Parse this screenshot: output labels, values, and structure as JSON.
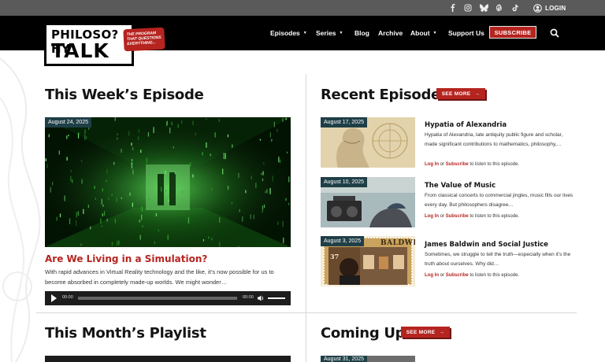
{
  "topbar": {
    "social": [
      "facebook-icon",
      "instagram-icon",
      "bluesky-icon",
      "threads-icon",
      "tiktok-icon"
    ],
    "login_label": "LOGIN"
  },
  "brand": {
    "line1": "PHILOSO?HY",
    "line2": "TALK",
    "tagline": "THE PROGRAM THAT QUESTIONS EVERYTHING..."
  },
  "nav": {
    "items": [
      {
        "label": "Episodes",
        "dropdown": true
      },
      {
        "label": "Series",
        "dropdown": true
      },
      {
        "label": "Blog",
        "dropdown": false
      },
      {
        "label": "Archive",
        "dropdown": false
      },
      {
        "label": "About",
        "dropdown": true
      },
      {
        "label": "Support Us",
        "dropdown": false
      }
    ],
    "subscribe_label": "SUBSCRIBE"
  },
  "this_week": {
    "heading": "This Week’s Episode",
    "date": "August 24, 2025",
    "title": "Are We Living in a Simulation?",
    "description": "With rapid advances in Virtual Reality technology and the like, it’s now possible for us to become absorbed in completely made-up worlds. We might wonder…",
    "player": {
      "current_time": "00:00",
      "duration": "00:00",
      "progress": 0
    }
  },
  "recent": {
    "heading": "Recent Episodes",
    "see_more_label": "SEE MORE",
    "episodes": [
      {
        "date": "August 17, 2025",
        "title": "Hypatia of Alexandria",
        "description": "Hypatia of Alexandria, late antiquity public figure and scholar, made significant contributions to mathematics, philosophy,…",
        "login_link": "Log In",
        "or_text": "or",
        "subscribe_link": "Subscribe",
        "suffix": "to listen to this episode."
      },
      {
        "date": "August 10, 2025",
        "title": "The Value of Music",
        "description": "From classical concerts to commercial jingles, music fills our lives every day. But philosophers disagree…",
        "login_link": "Log In",
        "or_text": "or",
        "subscribe_link": "Subscribe",
        "suffix": "to listen to this episode."
      },
      {
        "date": "August 3, 2025",
        "title": "James Baldwin and Social Justice",
        "description": "Sometimes, we struggle to tell the truth—especially when it’s the truth about ourselves. Why did…",
        "login_link": "Log In",
        "or_text": "or",
        "subscribe_link": "Subscribe",
        "suffix": "to listen to this episode.",
        "stamp_text": "BALDWIN",
        "stamp_value": "37"
      }
    ]
  },
  "playlist": {
    "heading": "This Month’s Playlist"
  },
  "coming_up": {
    "heading": "Coming Up",
    "see_more_label": "SEE MORE",
    "first_date": "August 31, 2025"
  },
  "colors": {
    "brand_red": "#b5241f",
    "nav_bg": "#000000",
    "topbar_bg": "#5a5a5a",
    "date_badge": "#1f3f47"
  }
}
